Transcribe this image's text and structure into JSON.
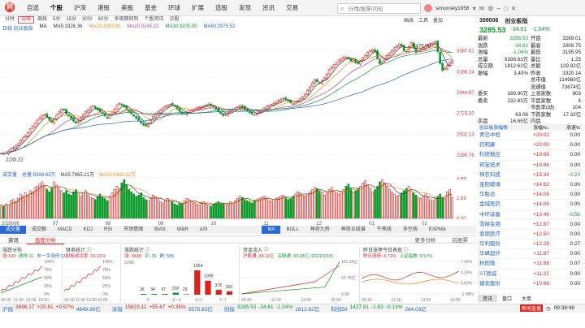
{
  "app": {
    "logo": "同",
    "menu": [
      "自选",
      "个股",
      "沪深",
      "港股",
      "美股",
      "基金",
      "环球",
      "扩展",
      "选股",
      "发现",
      "资讯",
      "交易"
    ],
    "active_menu": 1,
    "search_placeholder": "行情/股票/问句",
    "username": "simonsky1958"
  },
  "toolbar": {
    "items": [
      "分时",
      "日线",
      "周线",
      "5分",
      "15分",
      "30分",
      "60分",
      "多周期同列",
      "个股资讯",
      "诊股"
    ],
    "selected": 1,
    "right": [
      "画线",
      "工具",
      "叠加"
    ]
  },
  "ma_legend": {
    "label": "日线 创业板指",
    "ma": "MA",
    "ma5": "MA5:3326.36",
    "ma10": "MA10:3263.85",
    "ma20": "MA20:3245.22",
    "ma30": "MA30:3205.05",
    "ma60": "MA60:2975.52"
  },
  "chart_data": {
    "type": "candlestick",
    "y_ticks": [
      "3387.61",
      "3166.24",
      "2944.87",
      "2723.50",
      "2502.13",
      "2280.76"
    ],
    "y_range": [
      2170,
      3600
    ],
    "x_labels": [
      "2020/06",
      "07",
      "08",
      "09",
      "10",
      "11",
      "12",
      "01",
      "02"
    ],
    "high_label": "3476.00",
    "low_label": "2235.22",
    "volume_ticks": [
      "3.66",
      "1.83",
      "0.00"
    ],
    "volume_label": "成交量",
    "volume_total": "总量:9398.63万",
    "vol_ma5": "MA5:7865.21万",
    "vol_ma10": "MA10:8160.22万",
    "closes": [
      2300,
      2296,
      2305,
      2322,
      2345,
      2360,
      2378,
      2402,
      2440,
      2470,
      2488,
      2520,
      2560,
      2590,
      2620,
      2652,
      2680,
      2700,
      2710,
      2682,
      2650,
      2630,
      2660,
      2706,
      2740,
      2770,
      2760,
      2720,
      2695,
      2670,
      2640,
      2620,
      2645,
      2670,
      2710,
      2742,
      2760,
      2790,
      2805,
      2780,
      2760,
      2742,
      2720,
      2696,
      2675,
      2700,
      2740,
      2770,
      2812,
      2830,
      2812,
      2795,
      2770,
      2744,
      2720,
      2695,
      2672,
      2650,
      2622,
      2600,
      2590,
      2612,
      2650,
      2690,
      2720,
      2740,
      2760,
      2782,
      2800,
      2812,
      2822,
      2812,
      2795,
      2770,
      2744,
      2720,
      2720,
      2735,
      2750,
      2760,
      2770,
      2782,
      2790,
      2796,
      2802,
      2810,
      2820,
      2812,
      2795,
      2770,
      2745,
      2722,
      2700,
      2712,
      2732,
      2752,
      2770,
      2782,
      2795,
      2806,
      2790,
      2770,
      2750,
      2730,
      2718,
      2712,
      2722,
      2740,
      2762,
      2782,
      2800,
      2806,
      2820,
      2830,
      2842,
      2856,
      2875,
      2882,
      2872,
      2856,
      2836,
      2826,
      2842,
      2860,
      2880,
      2902,
      2932,
      2965,
      3002,
      3048,
      3080,
      3060,
      3042,
      3070,
      3102,
      3142,
      3188,
      3216,
      3240,
      3260,
      3290,
      3302,
      3322,
      3320,
      3302,
      3280,
      3300,
      3262,
      3252,
      3282,
      3312,
      3342,
      3372,
      3392,
      3402,
      3382,
      3302,
      3252,
      3270,
      3300,
      3340,
      3360,
      3392,
      3420,
      3440,
      3460,
      3440,
      3390,
      3380,
      3430,
      3476,
      3418,
      3372,
      3390,
      3402,
      3422,
      3440,
      3452,
      3465,
      3470,
      3485,
      3380,
      3252,
      3180,
      3200,
      3232,
      3264,
      3285.53
    ],
    "volumes": [
      1.2,
      1.1,
      1.3,
      1.2,
      1.6,
      1.7,
      1.5,
      1.8,
      2.2,
      2.0,
      2.3,
      2.1,
      2.5,
      2.4,
      2.8,
      2.9,
      3.1,
      3.3,
      2.9,
      2.6,
      2.4,
      2.8,
      3.3,
      3.0,
      2.7,
      2.5,
      2.3,
      2.5,
      2.2,
      2.1,
      2.4,
      2.6,
      2.2,
      2.0,
      2.3,
      2.5,
      2.1,
      1.9,
      1.8,
      1.7,
      2.0,
      2.2,
      1.9,
      1.8,
      1.6,
      2.0,
      2.3,
      2.6,
      2.9,
      2.7,
      3.2,
      3.5,
      3.0,
      2.6,
      2.4,
      2.2,
      2.0,
      2.1,
      2.3,
      1.9,
      1.7,
      1.6,
      1.8,
      2.1,
      1.9,
      1.7,
      1.5,
      1.4,
      1.6,
      1.8,
      1.6,
      1.5,
      1.3,
      1.2,
      1.4,
      1.3,
      1.6,
      1.8,
      1.7,
      1.5,
      1.4,
      1.3,
      1.2,
      1.4,
      1.5,
      1.3,
      1.2,
      1.1,
      1.3,
      1.4,
      1.5,
      1.4,
      1.3,
      1.2,
      1.3,
      1.5,
      1.4,
      1.6,
      1.8,
      2.0,
      1.9,
      1.7,
      1.6,
      1.5,
      1.4,
      1.6,
      1.7,
      1.8,
      1.9,
      2.0,
      1.8,
      1.6,
      1.5,
      1.7,
      1.8,
      1.9,
      2.0,
      2.1,
      1.9,
      1.7,
      1.8,
      2.0,
      2.2,
      2.4,
      2.3,
      2.1,
      2.0,
      2.2,
      2.4,
      2.6,
      2.8,
      2.7,
      2.5,
      2.3,
      2.1,
      2.4,
      2.6,
      2.8,
      2.5,
      2.3,
      2.2,
      2.4,
      2.6,
      2.9,
      3.1,
      2.7,
      2.4,
      2.5,
      2.7,
      2.9,
      3.2,
      3.4,
      3.0,
      2.7,
      2.4,
      2.6,
      2.9,
      3.3,
      3.5,
      3.2,
      2.9,
      2.6,
      2.4,
      2.2,
      2.0,
      2.1,
      2.3,
      2.5,
      2.7,
      2.9,
      2.6,
      2.3,
      2.1,
      1.9,
      1.8,
      2.0,
      2.2,
      1.9,
      1.7,
      1.6,
      1.8,
      2.0,
      2.2,
      1.9,
      1.8,
      2.4,
      2.6,
      1.9
    ]
  },
  "indicator_tabs": {
    "items": [
      "成交量",
      "成交额",
      "MACD",
      "KDJ",
      "RSI",
      "市场情绪",
      "BIAS",
      "W&R",
      "ASI",
      "",
      "MA",
      "BOLL",
      "神奇九转",
      "神奇五线谱",
      "牛熊线",
      "多空线",
      "EXPMA"
    ],
    "selected": [
      0,
      10
    ]
  },
  "sub_tabs": {
    "items": [
      "资讯",
      "盘面分析"
    ],
    "selected": 1,
    "right": [
      "更多分析",
      "后股票"
    ]
  },
  "panels": [
    {
      "title": "涨跌分布",
      "legend": [
        "涨:143",
        "跌停:11",
        "非一字涨停:131"
      ],
      "yticks": [
        "100%",
        "75%",
        "50%",
        "25%",
        "0%"
      ],
      "xticks": [
        "09:30",
        "11:30",
        "13:00",
        "15:00"
      ]
    },
    {
      "title": "财务统计 ⓘ",
      "legend": [
        "封板成功率: 91.61%"
      ],
      "yticks": [
        "100%",
        "75%",
        "50%",
        "25%",
        "0%"
      ],
      "xticks": [
        "09:30",
        "11:30",
        "13:00",
        "15:00"
      ]
    },
    {
      "title": "涨跌统计 ⓘ",
      "legend": [
        "涨: 3638",
        "平: 29",
        "跌: 505"
      ],
      "ytop": "2285",
      "bars": [
        {
          "v": 26,
          "l": "26",
          "c": "green"
        },
        {
          "v": 34,
          "l": "34",
          "c": "green"
        },
        {
          "v": 67,
          "l": "67",
          "c": "green"
        },
        {
          "v": 158,
          "l": "158",
          "c": "green"
        },
        {
          "v": 29,
          "l": "29",
          "c": "gray"
        },
        {
          "v": 1904,
          "l": "1904",
          "c": "red"
        },
        {
          "v": 1095,
          "l": "1095",
          "c": "red"
        },
        {
          "v": 378,
          "l": "378",
          "c": "red"
        },
        {
          "v": 260,
          "l": "260",
          "c": "red"
        }
      ],
      "xticks": [
        "0",
        "-3~-5",
        "0~3",
        "5~7"
      ]
    },
    {
      "title": "资金流入 ⓘ",
      "legend": [
        "沪股通: 34.11亿",
        "深股通: 93.68亿 (20210219)"
      ],
      "yticks": [
        "101.16亿",
        "50.78亿",
        "0.00"
      ],
      "xticks": [
        "09:30",
        "11:30",
        "13:00",
        "15:00"
      ]
    },
    {
      "title": "昨日涨停今日表现 ⓘ",
      "legend": [
        "昨日涨停: 4.71%",
        "上证指数: 0.57%"
      ],
      "yticks": [
        "7.25%",
        "3.39%",
        "0.00%",
        "-2.88%"
      ],
      "xticks": [
        "09:30",
        "11:30",
        "13:00",
        "15:00"
      ]
    }
  ],
  "quote": {
    "code": "399006",
    "name": "创业板指",
    "price": "3285.53",
    "open_label": "开盘",
    "change": "-34.61",
    "pct": "-1.04%"
  },
  "stats": [
    [
      "最新",
      "3285.53",
      "开盘",
      "3289.01"
    ],
    [
      "涨跌",
      "-34.61",
      "最高",
      "3308.75"
    ],
    [
      "涨幅",
      "-1.04%",
      "最低",
      "3195.95"
    ],
    [
      "总量",
      "9398.63万",
      "量比",
      "1.25"
    ],
    [
      "成交额",
      "1812.62亿",
      "总额",
      "129.92亿"
    ],
    [
      "振幅",
      "3.40%",
      "昨收",
      "3320.14"
    ],
    [
      "",
      "",
      "总市值",
      "114980亿"
    ],
    [
      "",
      "",
      "流通值",
      "73674亿"
    ],
    [
      "委买",
      "189.90万",
      "上涨家数",
      "803"
    ],
    [
      "委卖",
      "232.83万",
      "平盘家数",
      "4"
    ],
    [
      "",
      "",
      "市盈率(动)",
      "104"
    ],
    [
      "",
      "63.06",
      "下跌家数",
      "17.32亿"
    ],
    [
      "买盘",
      "16.65亿",
      "内盘",
      ""
    ]
  ],
  "rise_header": [
    "创业板涨幅榜",
    "涨幅%↓",
    "涨速%"
  ],
  "rise_list": [
    [
      "青岛中程",
      "+20.02",
      "0.00"
    ],
    [
      "药明康",
      "+20.00",
      "0.00"
    ],
    [
      "科德数控",
      "+19.98",
      "0.00"
    ],
    [
      "邦宝技术",
      "+19.96",
      "0.00"
    ],
    [
      "神农科技",
      "+15.34",
      "-0.23"
    ],
    [
      "金刚玻璃",
      "+14.92",
      "0.00"
    ],
    [
      "华胜达",
      "+14.08",
      "0.00"
    ],
    [
      "金城医药",
      "+14.08",
      "0.00"
    ],
    [
      "中环装备",
      "+13.46",
      "-0.56"
    ],
    [
      "雪榕生物",
      "+12.87",
      "0.00"
    ],
    [
      "爱朋医疗",
      "+12.50",
      "0.00"
    ],
    [
      "华利股份",
      "+12.28",
      "0.27"
    ],
    [
      "华峰超纤",
      "+11.97",
      "0.00"
    ],
    [
      "秋田微",
      "+11.98",
      "0.07"
    ],
    [
      "ST德威",
      "+11.22",
      "0.00"
    ],
    [
      "捷安股份",
      "+10.86",
      "0.00"
    ]
  ],
  "right_tabs": [
    "资讯",
    "盘口",
    "大单"
  ],
  "statusbar": [
    [
      "沪指",
      "3696.17",
      "+20.81",
      "+0.57%",
      "4849.90亿"
    ],
    [
      "深指",
      "15823.11",
      "+55.67",
      "+0.35%",
      "5575.83亿"
    ],
    [
      "创指",
      "3285.53",
      "-34.61",
      "-1.04%",
      "1812.62亿"
    ],
    [
      "科创50",
      "1427.91",
      "-1.83",
      "-0.13%",
      "264.03亿"
    ]
  ],
  "news_badge": "新闻直播",
  "clock": "09:38:48"
}
